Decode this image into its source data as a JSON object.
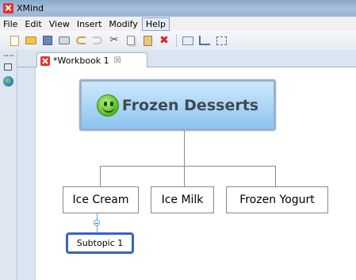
{
  "window": {
    "title": "XMind"
  },
  "menu": {
    "items": [
      "File",
      "Edit",
      "View",
      "Insert",
      "Modify",
      "Help"
    ],
    "active": "Help"
  },
  "toolbar": {
    "icons": [
      "new-document-icon",
      "open-folder-icon",
      "save-icon",
      "print-icon",
      "undo-icon",
      "redo-icon",
      "cut-icon",
      "copy-icon",
      "paste-icon",
      "delete-icon",
      "insert-topic-icon",
      "insert-subtopic-icon",
      "insert-floating-topic-icon"
    ]
  },
  "editor": {
    "tab_label": "*Workbook 1",
    "tab_close": "☒"
  },
  "mindmap": {
    "central_topic": "Frozen Desserts",
    "central_icon": "smiley-icon",
    "topics": [
      "Ice Cream",
      "Ice Milk",
      "Frozen Yogurt"
    ],
    "subtopic": "Subtopic 1"
  },
  "colors": {
    "central_fill": "#8cc4ef",
    "subtopic_border": "#3a62c0",
    "logo_red": "#e2332b"
  }
}
